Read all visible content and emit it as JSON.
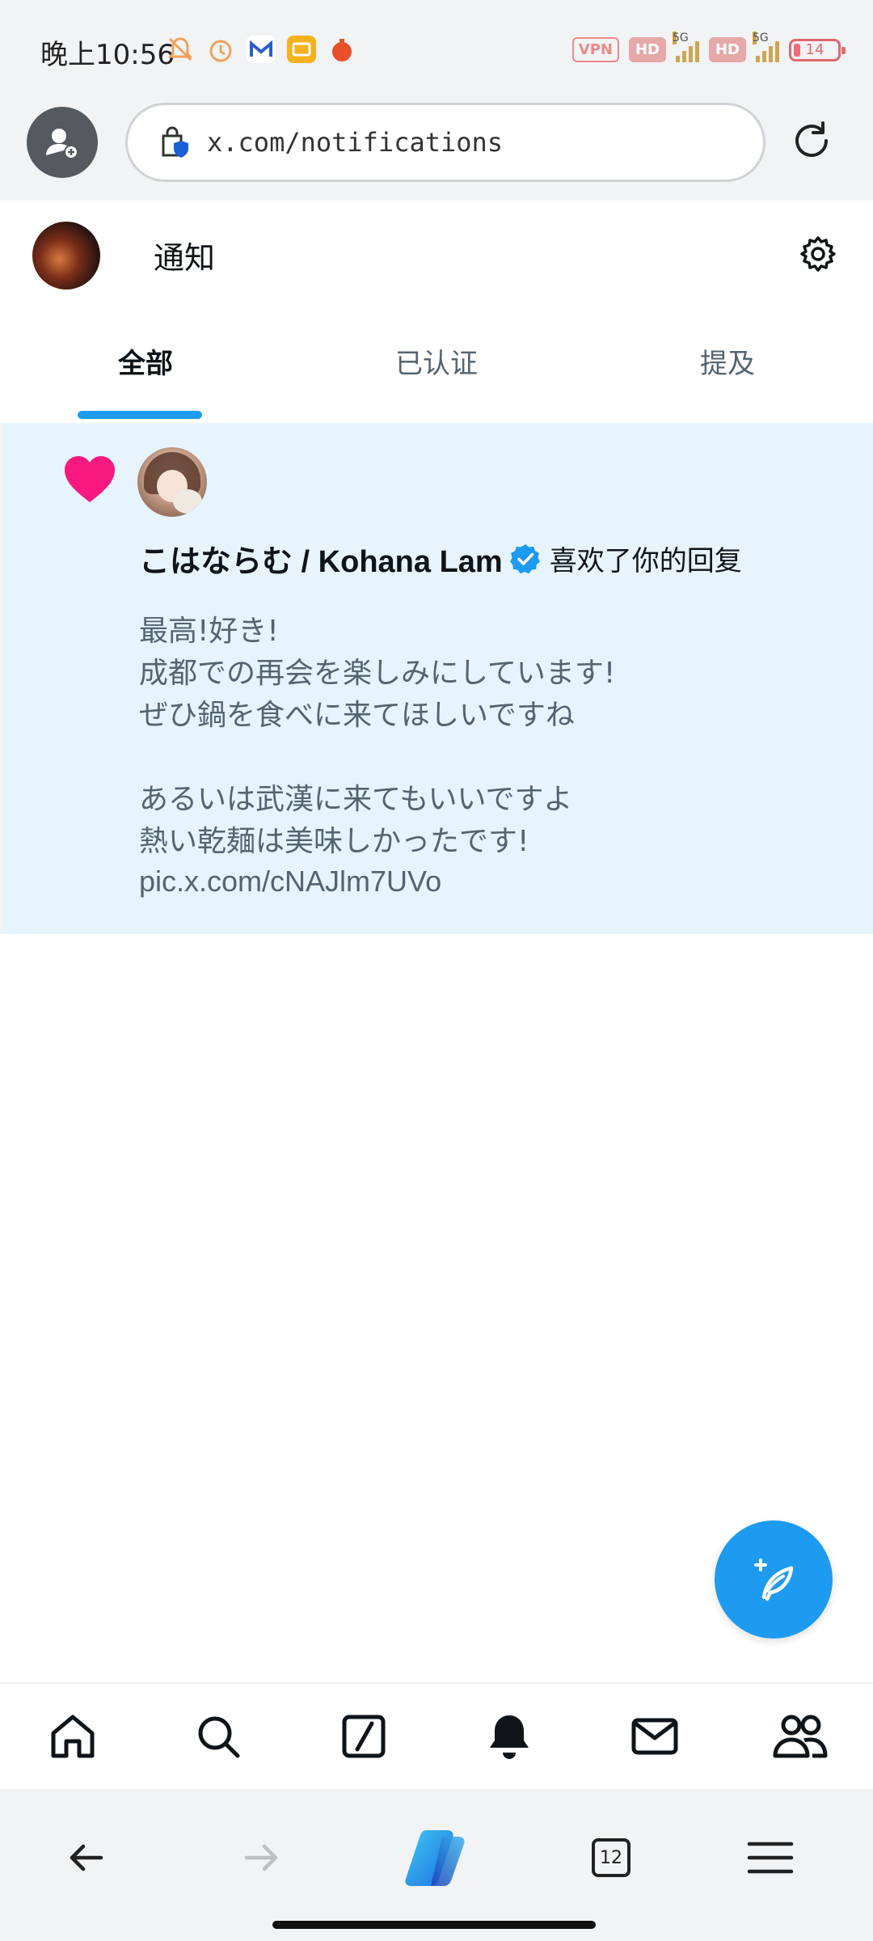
{
  "status_bar": {
    "time": "晚上10:56",
    "left_icons": [
      "mute-bell-icon",
      "alarm-icon",
      "mail-app-icon",
      "message-app-icon",
      "app-icon"
    ],
    "vpn": "VPN",
    "hd1": "HD",
    "hd2": "HD",
    "net1": "5G",
    "net2": "5G",
    "battery": "14"
  },
  "browser": {
    "url": "x.com/notifications"
  },
  "header": {
    "title": "通知"
  },
  "tabs": [
    {
      "label": "全部",
      "active": true
    },
    {
      "label": "已认证",
      "active": false
    },
    {
      "label": "提及",
      "active": false
    }
  ],
  "notification": {
    "user": "こはならむ / Kohana Lam",
    "action": "喜欢了你的回复",
    "body": "最高!好き!\n成都での再会を楽しみにしています!\nぜひ鍋を食べに来てほしいですね\n\nあるいは武漢に来てもいいですよ\n熱い乾麺は美味しかったです!",
    "link": "pic.x.com/cNAJlm7UVo"
  },
  "bottom_nav": [
    "home-icon",
    "search-icon",
    "grok-icon",
    "notifications-icon",
    "messages-icon",
    "communities-icon"
  ],
  "browser_bottom": {
    "tab_count": "12"
  },
  "colors": {
    "accent": "#1d9bf0",
    "like": "#f91880",
    "highlight_bg": "#e7f3fd"
  }
}
